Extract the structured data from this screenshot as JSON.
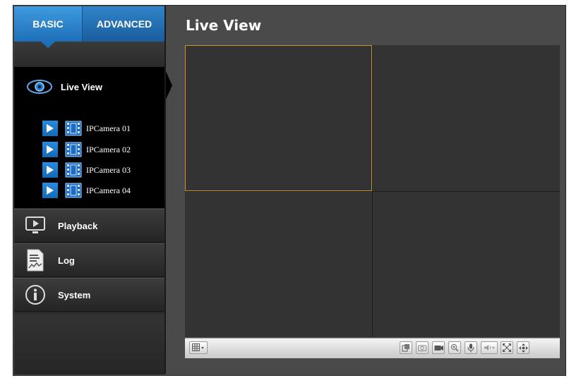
{
  "tabs": {
    "basic": "BASIC",
    "advanced": "ADVANCED"
  },
  "sidebar": {
    "live_view": {
      "label": "Live View",
      "icon": "eye-icon"
    },
    "cameras": [
      {
        "label": "IPCamera 01"
      },
      {
        "label": "IPCamera 02"
      },
      {
        "label": "IPCamera 03"
      },
      {
        "label": "IPCamera 04"
      }
    ],
    "menu": [
      {
        "label": "Playback",
        "icon": "playback-icon"
      },
      {
        "label": "Log",
        "icon": "log-icon"
      },
      {
        "label": "System",
        "icon": "info-icon"
      }
    ]
  },
  "main": {
    "title": "Live View",
    "grid_layout": "2x2",
    "selected_cell": 1
  },
  "toolbar": {
    "layout_icon": "layout-grid-icon",
    "right_icons": [
      "stop-all-icon",
      "snapshot-icon",
      "record-icon",
      "zoom-icon",
      "microphone-icon",
      "speaker-icon",
      "fullscreen-icon",
      "ptz-icon"
    ]
  },
  "colors": {
    "accent": "#1e6fb8",
    "selection": "#c8962a"
  }
}
